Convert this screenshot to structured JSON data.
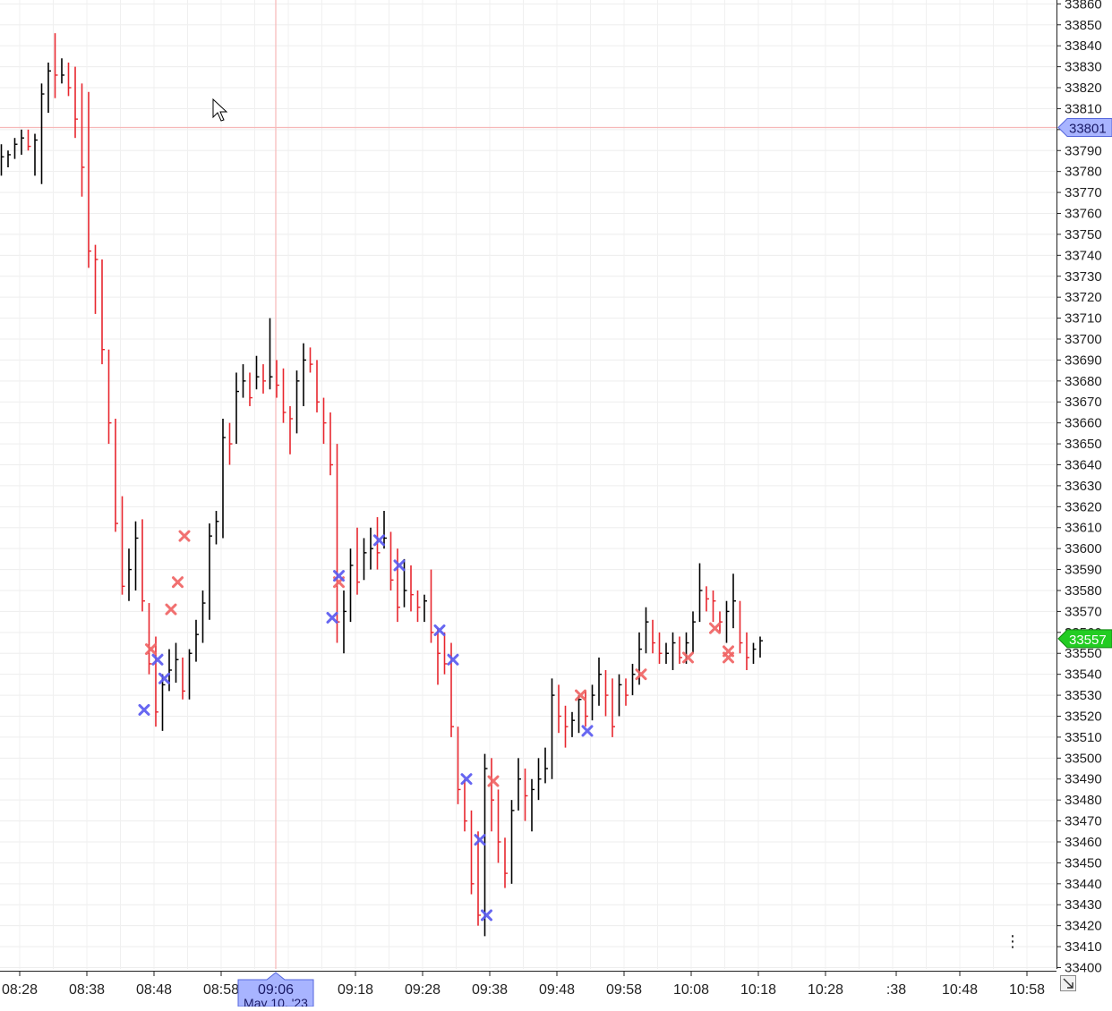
{
  "chart_data": {
    "type": "ohlc",
    "title": "",
    "xlabel": "",
    "ylabel": "",
    "ylim": [
      33395,
      33862
    ],
    "y_ticks": [
      33410,
      33420,
      33430,
      33440,
      33450,
      33460,
      33470,
      33480,
      33490,
      33500,
      33510,
      33520,
      33530,
      33540,
      33550,
      33560,
      33570,
      33580,
      33590,
      33600,
      33610,
      33620,
      33630,
      33640,
      33650,
      33660,
      33670,
      33680,
      33690,
      33700,
      33710,
      33720,
      33730,
      33740,
      33750,
      33760,
      33770,
      33780,
      33790,
      33800,
      33810,
      33820,
      33830,
      33840,
      33850,
      33860
    ],
    "y_tick_labels": [
      "33400",
      "33410",
      "33420",
      "33430",
      "33440",
      "33450",
      "33460",
      "33470",
      "33480",
      "33490",
      "33500",
      "33510",
      "33520",
      "33530",
      "33540",
      "33550",
      "33560",
      "33570",
      "33580",
      "33590",
      "33600",
      "33610",
      "33620",
      "33630",
      "33640",
      "33650",
      "33660",
      "33670",
      "33680",
      "33690",
      "33700",
      "33710",
      "33720",
      "33730",
      "33740",
      "33750",
      "33760",
      "33770",
      "33780",
      "33790",
      "33800",
      "33810",
      "33820",
      "33830",
      "33840",
      "33850",
      "33860"
    ],
    "x_time_start": "08:26",
    "x_tick_labels": [
      "08:28",
      "08:38",
      "08:48",
      "08:58",
      "09:18",
      "09:28",
      "09:38",
      "09:48",
      "09:58",
      "10:08",
      "10:18",
      "10:28",
      ":38",
      "10:48",
      "10:58"
    ],
    "crosshair": {
      "price": 33801,
      "price_label": "33801",
      "time_label": "09:06",
      "date_label": "May 10, '23"
    },
    "last_price": {
      "price": 33557,
      "label": "33557"
    },
    "grid": true,
    "colors": {
      "up": "#000000",
      "down": "#e8262e",
      "buy_marker": "#5a5af0",
      "sell_marker": "#f06464",
      "crosshair": "#f6b8b8",
      "last_price_bg": "#22cc22",
      "crosshair_label_bg": "#a8b4ff"
    },
    "bars": [
      {
        "high": 33793,
        "low": 33778,
        "c": 33787
      },
      {
        "high": 33790,
        "low": 33782,
        "c": 33788
      },
      {
        "high": 33796,
        "low": 33786,
        "c": 33793
      },
      {
        "high": 33800,
        "low": 33788,
        "c": 33796
      },
      {
        "high": 33800,
        "low": 33790,
        "c": 33792
      },
      {
        "high": 33798,
        "low": 33778,
        "c": 33795
      },
      {
        "high": 33822,
        "low": 33774,
        "c": 33817
      },
      {
        "high": 33832,
        "low": 33808,
        "c": 33828
      },
      {
        "high": 33846,
        "low": 33815,
        "c": 33826
      },
      {
        "high": 33834,
        "low": 33822,
        "c": 33826
      },
      {
        "high": 33832,
        "low": 33816,
        "c": 33820
      },
      {
        "high": 33830,
        "low": 33796,
        "c": 33805
      },
      {
        "high": 33822,
        "low": 33768,
        "c": 33782
      },
      {
        "high": 33818,
        "low": 33734,
        "c": 33742
      },
      {
        "high": 33745,
        "low": 33712,
        "c": 33738
      },
      {
        "high": 33738,
        "low": 33688,
        "c": 33695
      },
      {
        "high": 33695,
        "low": 33650,
        "c": 33660
      },
      {
        "high": 33662,
        "low": 33608,
        "c": 33612
      },
      {
        "high": 33625,
        "low": 33578,
        "c": 33582
      },
      {
        "high": 33600,
        "low": 33575,
        "c": 33590
      },
      {
        "high": 33613,
        "low": 33580,
        "c": 33605
      },
      {
        "high": 33614,
        "low": 33570,
        "c": 33575
      },
      {
        "high": 33574,
        "low": 33540,
        "c": 33545
      },
      {
        "high": 33558,
        "low": 33515,
        "c": 33522
      },
      {
        "high": 33540,
        "low": 33513,
        "c": 33535
      },
      {
        "high": 33552,
        "low": 33532,
        "c": 33542
      },
      {
        "high": 33555,
        "low": 33536,
        "c": 33547
      },
      {
        "high": 33548,
        "low": 33528,
        "c": 33532
      },
      {
        "high": 33552,
        "low": 33528,
        "c": 33550
      },
      {
        "high": 33566,
        "low": 33546,
        "c": 33559
      },
      {
        "high": 33580,
        "low": 33555,
        "c": 33574
      },
      {
        "high": 33612,
        "low": 33566,
        "c": 33606
      },
      {
        "high": 33618,
        "low": 33602,
        "c": 33613
      },
      {
        "high": 33662,
        "low": 33605,
        "c": 33653
      },
      {
        "high": 33660,
        "low": 33640,
        "c": 33650
      },
      {
        "high": 33684,
        "low": 33650,
        "c": 33675
      },
      {
        "high": 33688,
        "low": 33672,
        "c": 33680
      },
      {
        "high": 33684,
        "low": 33668,
        "c": 33672
      },
      {
        "high": 33692,
        "low": 33676,
        "c": 33682
      },
      {
        "high": 33688,
        "low": 33674,
        "c": 33680
      },
      {
        "high": 33710,
        "low": 33676,
        "c": 33682
      },
      {
        "high": 33690,
        "low": 33672,
        "c": 33678
      },
      {
        "high": 33686,
        "low": 33660,
        "c": 33665
      },
      {
        "high": 33668,
        "low": 33645,
        "c": 33662
      },
      {
        "high": 33685,
        "low": 33655,
        "c": 33680
      },
      {
        "high": 33698,
        "low": 33668,
        "c": 33690
      },
      {
        "high": 33696,
        "low": 33684,
        "c": 33688
      },
      {
        "high": 33690,
        "low": 33665,
        "c": 33670
      },
      {
        "high": 33672,
        "low": 33650,
        "c": 33660
      },
      {
        "high": 33665,
        "low": 33635,
        "c": 33640
      },
      {
        "high": 33650,
        "low": 33555,
        "c": 33565
      },
      {
        "high": 33580,
        "low": 33550,
        "c": 33570
      },
      {
        "high": 33600,
        "low": 33565,
        "c": 33592
      },
      {
        "high": 33610,
        "low": 33578,
        "c": 33584
      },
      {
        "high": 33605,
        "low": 33585,
        "c": 33598
      },
      {
        "high": 33610,
        "low": 33590,
        "c": 33600
      },
      {
        "high": 33615,
        "low": 33590,
        "c": 33598
      },
      {
        "high": 33618,
        "low": 33600,
        "c": 33605
      },
      {
        "high": 33608,
        "low": 33580,
        "c": 33585
      },
      {
        "high": 33600,
        "low": 33565,
        "c": 33572
      },
      {
        "high": 33595,
        "low": 33572,
        "c": 33580
      },
      {
        "high": 33592,
        "low": 33570,
        "c": 33578
      },
      {
        "high": 33580,
        "low": 33565,
        "c": 33572
      },
      {
        "high": 33578,
        "low": 33565,
        "c": 33575
      },
      {
        "high": 33590,
        "low": 33555,
        "c": 33560
      },
      {
        "high": 33562,
        "low": 33535,
        "c": 33550
      },
      {
        "high": 33560,
        "low": 33540,
        "c": 33545
      },
      {
        "high": 33555,
        "low": 33510,
        "c": 33515
      },
      {
        "high": 33515,
        "low": 33478,
        "c": 33485
      },
      {
        "high": 33490,
        "low": 33465,
        "c": 33470
      },
      {
        "high": 33475,
        "low": 33435,
        "c": 33440
      },
      {
        "high": 33465,
        "low": 33420,
        "c": 33425
      },
      {
        "high": 33502,
        "low": 33415,
        "c": 33495
      },
      {
        "high": 33500,
        "low": 33465,
        "c": 33480
      },
      {
        "high": 33485,
        "low": 33450,
        "c": 33460
      },
      {
        "high": 33462,
        "low": 33438,
        "c": 33445
      },
      {
        "high": 33480,
        "low": 33440,
        "c": 33475
      },
      {
        "high": 33500,
        "low": 33475,
        "c": 33490
      },
      {
        "high": 33495,
        "low": 33470,
        "c": 33482
      },
      {
        "high": 33490,
        "low": 33465,
        "c": 33485
      },
      {
        "high": 33500,
        "low": 33480,
        "c": 33490
      },
      {
        "high": 33505,
        "low": 33488,
        "c": 33495
      },
      {
        "high": 33538,
        "low": 33490,
        "c": 33530
      },
      {
        "high": 33535,
        "low": 33512,
        "c": 33520
      },
      {
        "high": 33525,
        "low": 33505,
        "c": 33515
      },
      {
        "high": 33522,
        "low": 33510,
        "c": 33518
      },
      {
        "high": 33530,
        "low": 33512,
        "c": 33528
      },
      {
        "high": 33532,
        "low": 33515,
        "c": 33520
      },
      {
        "high": 33535,
        "low": 33518,
        "c": 33530
      },
      {
        "high": 33548,
        "low": 33525,
        "c": 33540
      },
      {
        "high": 33542,
        "low": 33520,
        "c": 33530
      },
      {
        "high": 33538,
        "low": 33510,
        "c": 33515
      },
      {
        "high": 33540,
        "low": 33520,
        "c": 33535
      },
      {
        "high": 33538,
        "low": 33525,
        "c": 33530
      },
      {
        "high": 33545,
        "low": 33530,
        "c": 33540
      },
      {
        "high": 33560,
        "low": 33535,
        "c": 33552
      },
      {
        "high": 33572,
        "low": 33550,
        "c": 33565
      },
      {
        "high": 33566,
        "low": 33550,
        "c": 33555
      },
      {
        "high": 33560,
        "low": 33545,
        "c": 33550
      },
      {
        "high": 33555,
        "low": 33545,
        "c": 33550
      },
      {
        "high": 33560,
        "low": 33542,
        "c": 33555
      },
      {
        "high": 33558,
        "low": 33545,
        "c": 33548
      },
      {
        "high": 33560,
        "low": 33545,
        "c": 33555
      },
      {
        "high": 33570,
        "low": 33550,
        "c": 33565
      },
      {
        "high": 33593,
        "low": 33565,
        "c": 33580
      },
      {
        "high": 33582,
        "low": 33570,
        "c": 33576
      },
      {
        "high": 33580,
        "low": 33565,
        "c": 33575
      },
      {
        "high": 33570,
        "low": 33560,
        "c": 33565
      },
      {
        "high": 33575,
        "low": 33555,
        "c": 33570
      },
      {
        "high": 33588,
        "low": 33562,
        "c": 33575
      },
      {
        "high": 33575,
        "low": 33550,
        "c": 33555
      },
      {
        "high": 33560,
        "low": 33542,
        "c": 33548
      },
      {
        "high": 33555,
        "low": 33545,
        "c": 33552
      },
      {
        "high": 33558,
        "low": 33548,
        "c": 33556
      }
    ],
    "markers": [
      {
        "bar": 21,
        "side": "buy",
        "price": 33523
      },
      {
        "bar": 22,
        "side": "sell",
        "price": 33552
      },
      {
        "bar": 23,
        "side": "buy",
        "price": 33547
      },
      {
        "bar": 24,
        "side": "buy",
        "price": 33538
      },
      {
        "bar": 25,
        "side": "sell",
        "price": 33571
      },
      {
        "bar": 26,
        "side": "sell",
        "price": 33584
      },
      {
        "bar": 27,
        "side": "sell",
        "price": 33606
      },
      {
        "bar": 49,
        "side": "buy",
        "price": 33567
      },
      {
        "bar": 50,
        "side": "sell",
        "price": 33584
      },
      {
        "bar": 50,
        "side": "buy",
        "price": 33587
      },
      {
        "bar": 56,
        "side": "buy",
        "price": 33604
      },
      {
        "bar": 59,
        "side": "buy",
        "price": 33592
      },
      {
        "bar": 65,
        "side": "buy",
        "price": 33561
      },
      {
        "bar": 67,
        "side": "buy",
        "price": 33547
      },
      {
        "bar": 69,
        "side": "buy",
        "price": 33490
      },
      {
        "bar": 71,
        "side": "buy",
        "price": 33461
      },
      {
        "bar": 72,
        "side": "buy",
        "price": 33425
      },
      {
        "bar": 73,
        "side": "sell",
        "price": 33489
      },
      {
        "bar": 86,
        "side": "sell",
        "price": 33530
      },
      {
        "bar": 87,
        "side": "buy",
        "price": 33513
      },
      {
        "bar": 95,
        "side": "sell",
        "price": 33540
      },
      {
        "bar": 102,
        "side": "sell",
        "price": 33548
      },
      {
        "bar": 106,
        "side": "sell",
        "price": 33562
      },
      {
        "bar": 108,
        "side": "sell",
        "price": 33551
      },
      {
        "bar": 108,
        "side": "sell",
        "price": 33548
      }
    ]
  }
}
